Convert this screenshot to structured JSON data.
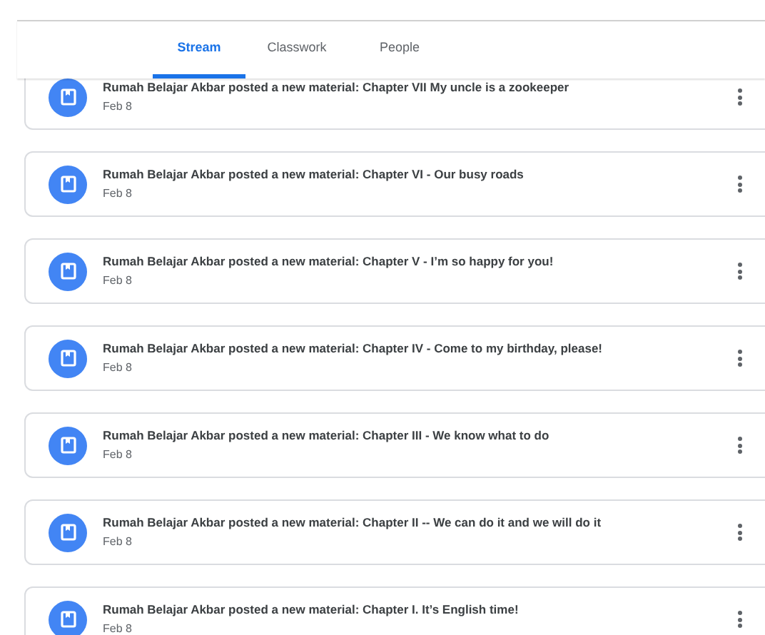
{
  "tabs": [
    {
      "label": "Stream",
      "selected": true
    },
    {
      "label": "Classwork",
      "selected": false
    },
    {
      "label": "People",
      "selected": false
    }
  ],
  "posts": [
    {
      "title": "Rumah Belajar Akbar posted a new material: Chapter VII My uncle is a zookeeper",
      "date": "Feb 8"
    },
    {
      "title": "Rumah Belajar Akbar posted a new material: Chapter VI - Our busy roads",
      "date": "Feb 8"
    },
    {
      "title": "Rumah Belajar Akbar posted a new material: Chapter V - I’m so happy for you!",
      "date": "Feb 8"
    },
    {
      "title": "Rumah Belajar Akbar posted a new material: Chapter IV - Come to my birthday, please!",
      "date": "Feb 8"
    },
    {
      "title": "Rumah Belajar Akbar posted a new material: Chapter III - We know what to do",
      "date": "Feb 8"
    },
    {
      "title": "Rumah Belajar Akbar posted a new material: Chapter II -- We can do it and we will do it",
      "date": "Feb 8"
    },
    {
      "title": "Rumah Belajar Akbar posted a new material: Chapter I. It’s English time!",
      "date": "Feb 8"
    }
  ]
}
